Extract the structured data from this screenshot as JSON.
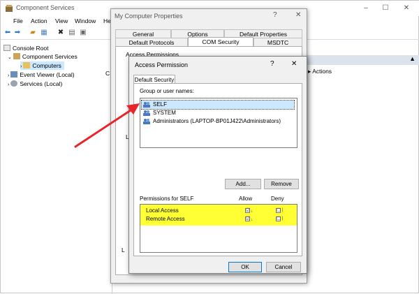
{
  "main": {
    "title": "Component Services",
    "window_controls": {
      "minimize": "–",
      "maximize": "☐",
      "close": "✕"
    },
    "menu": [
      "File",
      "Action",
      "View",
      "Window",
      "He"
    ],
    "tree": [
      {
        "label": "Console Root"
      },
      {
        "label": "Component Services"
      },
      {
        "label": "Computers"
      },
      {
        "label": "Event Viewer (Local)"
      },
      {
        "label": "Services (Local)"
      }
    ],
    "bleed_c": "C",
    "actions_more": "Actions",
    "actions_arrow": "▸"
  },
  "props": {
    "title": "My Computer Properties",
    "help": "?",
    "close": "✕",
    "tabs_row1": [
      "General",
      "Options",
      "Default Properties"
    ],
    "tabs_row2": [
      "Default Protocols",
      "COM Security",
      "MSDTC"
    ],
    "bleed_access": "Access Permissions",
    "bleed_l1": "L",
    "bleed_l2": "L"
  },
  "dlg": {
    "title": "Access Permission",
    "help": "?",
    "close": "✕",
    "tab": "Default Security",
    "group_label": "Group or user names:",
    "users": [
      "SELF",
      "SYSTEM",
      "Administrators (LAPTOP-BP01J422\\Administrators)"
    ],
    "add_button": "Add...",
    "remove_button": "Remove",
    "perm_for": "Permissions for SELF",
    "allow_header": "Allow",
    "deny_header": "Deny",
    "permissions": [
      {
        "name": "Local Access",
        "allow": "☑",
        "deny": "☐"
      },
      {
        "name": "Remote Access",
        "allow": "☑",
        "deny": "☐"
      }
    ],
    "ok_button": "OK",
    "cancel_button": "Cancel"
  },
  "colors": {
    "highlight": "#ffff33",
    "selection": "#cce8ff",
    "arrow": "#e8252a"
  }
}
